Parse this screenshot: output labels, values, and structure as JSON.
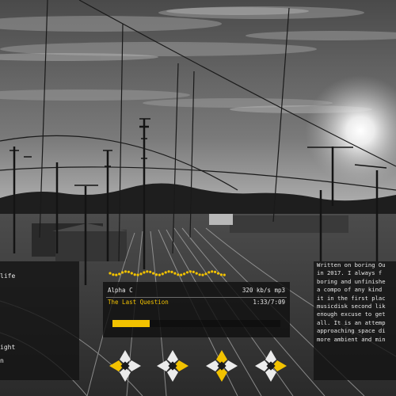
{
  "background": {
    "scene": "railway-yard-photo-grayscale"
  },
  "left_panel": {
    "items": [
      {
        "label": "life"
      },
      {
        "label": "ight"
      },
      {
        "label": "n"
      }
    ]
  },
  "player": {
    "artist": "Alpha C",
    "bitrate": "320 kb/s mp3",
    "title": "The Last Question",
    "elapsed": "1:33/7:09",
    "progress": 0.22,
    "accent_color": "#f2c200"
  },
  "description_panel": {
    "lines": [
      "Written on boring Ou",
      "in 2017. I always f",
      "boring and unfinishe",
      "a compo of any kind",
      "it in the first plac",
      "musicdisk second lik",
      "enough excuse to get",
      "all. It is an attemp",
      "approaching space di",
      "more ambient and min"
    ]
  },
  "controls": [
    {
      "name": "previous-button",
      "icon": "prev-icon"
    },
    {
      "name": "play-button",
      "icon": "play-icon"
    },
    {
      "name": "stop-button",
      "icon": "stop-icon"
    },
    {
      "name": "next-button",
      "icon": "next-icon"
    }
  ]
}
